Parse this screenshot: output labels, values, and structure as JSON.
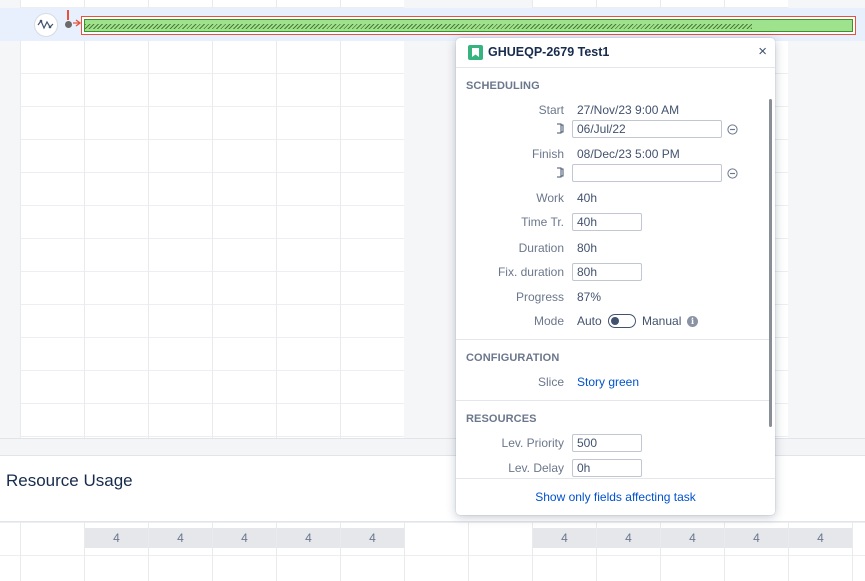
{
  "gantt": {
    "row_icon": "roadmap-avatar-icon",
    "task_bar": {
      "progress_fraction": 0.87,
      "color": "#9fe28d",
      "border_color": "#e5533d"
    }
  },
  "resource_usage": {
    "title": "Resource Usage",
    "cells": [
      "4",
      "4",
      "4",
      "4",
      "4",
      "4",
      "4",
      "4",
      "4",
      "4"
    ]
  },
  "popup": {
    "title": "GHUEQP-2679 Test1",
    "issue_type_icon": "story-bookmark-icon",
    "close_label": "×",
    "scheduling": {
      "heading": "SCHEDULING",
      "start_label": "Start",
      "start_value": "27/Nov/23 9:00 AM",
      "start_constraint_value": "06/Jul/22",
      "finish_label": "Finish",
      "finish_value": "08/Dec/23 5:00 PM",
      "finish_constraint_value": "",
      "work_label": "Work",
      "work_value": "40h",
      "time_tracked_label": "Time Tr.",
      "time_tracked_value": "40h",
      "duration_label": "Duration",
      "duration_value": "80h",
      "fixed_duration_label": "Fix. duration",
      "fixed_duration_value": "80h",
      "progress_label": "Progress",
      "progress_value": "87%",
      "mode_label": "Mode",
      "mode_auto": "Auto",
      "mode_manual": "Manual",
      "mode_info_glyph": "i"
    },
    "configuration": {
      "heading": "CONFIGURATION",
      "slice_label": "Slice",
      "slice_value": "Story green"
    },
    "resources": {
      "heading": "RESOURCES",
      "lev_priority_label": "Lev. Priority",
      "lev_priority_value": "500",
      "lev_delay_label": "Lev. Delay",
      "lev_delay_value": "0h"
    },
    "footer_link": "Show only fields affecting task"
  },
  "colors": {
    "accent_link": "#0052cc",
    "story_green": "#36b37e",
    "today_marker": "#e5533d"
  }
}
